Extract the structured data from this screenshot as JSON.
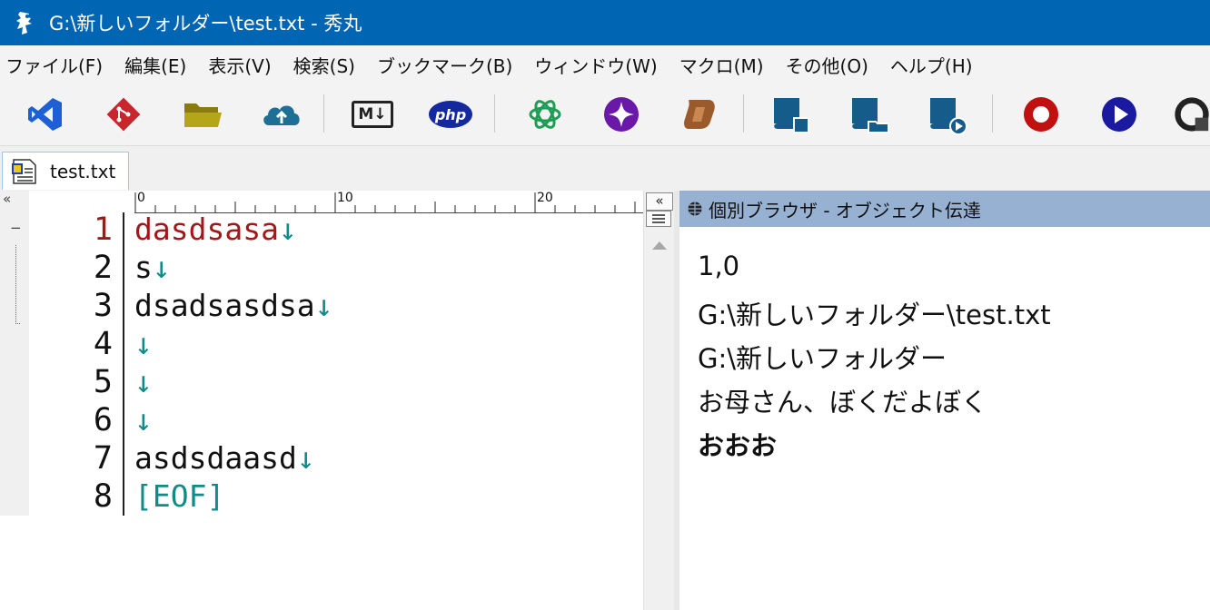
{
  "window": {
    "title": "G:\\新しいフォルダー\\test.txt  - 秀丸"
  },
  "menu": [
    {
      "label": "ファイル(F)"
    },
    {
      "label": "編集(E)"
    },
    {
      "label": "表示(V)"
    },
    {
      "label": "検索(S)"
    },
    {
      "label": "ブックマーク(B)"
    },
    {
      "label": "ウィンドウ(W)"
    },
    {
      "label": "マクロ(M)"
    },
    {
      "label": "その他(O)"
    },
    {
      "label": "ヘルプ(H)"
    }
  ],
  "toolbar": {
    "markdown_label": "M↓",
    "php_label": "php"
  },
  "tabs": [
    {
      "label": "test.txt"
    }
  ],
  "ruler": {
    "ticks": [
      "0",
      "10",
      "20"
    ]
  },
  "editor": {
    "lines": [
      {
        "num": "1",
        "text": "dasdsasa",
        "eol": "↓"
      },
      {
        "num": "2",
        "text": "s",
        "eol": "↓"
      },
      {
        "num": "3",
        "text": "dsadsasdsa",
        "eol": "↓"
      },
      {
        "num": "4",
        "text": "",
        "eol": "↓"
      },
      {
        "num": "5",
        "text": "",
        "eol": "↓"
      },
      {
        "num": "6",
        "text": "",
        "eol": "↓"
      },
      {
        "num": "7",
        "text": "asdsdaasd",
        "eol": "↓"
      },
      {
        "num": "8",
        "text": "",
        "eol": "[EOF]"
      }
    ],
    "current_line_color": "#a01818",
    "eol_color": "#118a8a"
  },
  "gutter": {
    "collapse_glyph": "«",
    "fold_glyph": "−"
  },
  "browser": {
    "title": "個別ブラウザ - オブジェクト伝達",
    "lines": [
      "1,0",
      "G:\\新しいフォルダー\\test.txt",
      "G:\\新しいフォルダー",
      "お母さん、ぼくだよぼく"
    ],
    "bold_line": "おおお"
  },
  "colors": {
    "titlebar": "#0065b3",
    "browser_header": "#96b1d1"
  }
}
